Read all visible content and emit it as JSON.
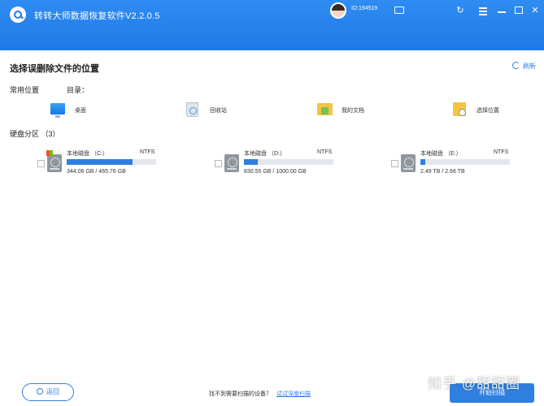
{
  "app": {
    "title": "转转大师数据恢复软件V2.2.0.5",
    "user_id": "ID:194519"
  },
  "page": {
    "title": "选择误删除文件的位置",
    "refresh_label": "刷新"
  },
  "sections": {
    "common_label": "常用位置",
    "dir_label": "目录：",
    "disk_label": "硬盘分区  （3）"
  },
  "locations": [
    {
      "label": "桌面",
      "icon": "desktop-icon"
    },
    {
      "label": "回收站",
      "icon": "recycle-bin-icon"
    },
    {
      "label": "我的文档",
      "icon": "documents-folder-icon"
    },
    {
      "label": "选择位置",
      "icon": "select-location-icon"
    }
  ],
  "drives": [
    {
      "name": "本地磁盘 （C:）",
      "fs": "NTFS",
      "size": "344.06 GB / 465.76 GB",
      "used_fraction": 0.74
    },
    {
      "name": "本地磁盘 （D:）",
      "fs": "NTFS",
      "size": "830.55 GB / 1000.00 GB",
      "used_fraction": 0.15
    },
    {
      "name": "本地磁盘 （E:）",
      "fs": "NTFS",
      "size": "2.49 TB / 2.66 TB",
      "used_fraction": 0.05
    }
  ],
  "footer": {
    "back_label": "返回",
    "cant_find": "找不到需要扫描的设备？",
    "deep_scan_link": "试试深度扫描",
    "start_label": "开始扫描",
    "watermark": "知乎 @甜甜圈"
  },
  "colors": {
    "accent": "#2f7fe0",
    "titlebar": "#1f7ae6"
  }
}
